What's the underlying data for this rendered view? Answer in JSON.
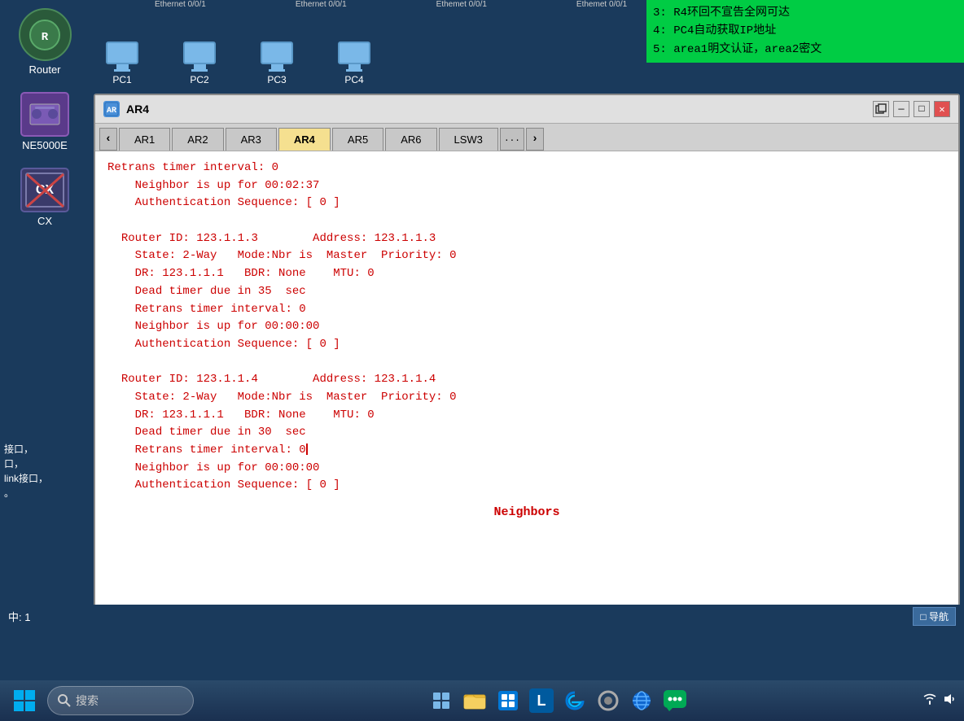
{
  "window": {
    "title": "AR4",
    "title_icon": "AR"
  },
  "tabs": [
    {
      "label": "AR1",
      "active": false
    },
    {
      "label": "AR2",
      "active": false
    },
    {
      "label": "AR3",
      "active": false
    },
    {
      "label": "AR4",
      "active": true
    },
    {
      "label": "AR5",
      "active": false
    },
    {
      "label": "AR6",
      "active": false
    },
    {
      "label": "LSW3",
      "active": false
    },
    {
      "label": "...",
      "active": false
    }
  ],
  "info_box": {
    "lines": [
      "3: R4环回不宣告全网可达",
      "4: PC4自动获取IP地址",
      "5: area1明文认证，area2密文"
    ]
  },
  "terminal": {
    "content_lines": [
      "Retrans timer interval: 0",
      "    Neighbor is up for 00:02:37",
      "    Authentication Sequence: [ 0 ]",
      "",
      "  Router ID: 123.1.1.3        Address: 123.1.1.3",
      "    State: 2-Way   Mode:Nbr is  Master  Priority: 0",
      "    DR: 123.1.1.1   BDR: None    MTU: 0",
      "    Dead timer due in 35  sec",
      "    Retrans timer interval: 0",
      "    Neighbor is up for 00:00:00",
      "    Authentication Sequence: [ 0 ]",
      "",
      "  Router ID: 123.1.1.4        Address: 123.1.1.4",
      "    State: 2-Way   Mode:Nbr is  Master  Priority: 0",
      "    DR: 123.1.1.1   BDR: None    MTU: 0",
      "    Dead timer due in 30  sec",
      "    Retrans timer interval: 0|",
      "    Neighbor is up for 00:00:00",
      "    Authentication Sequence: [ 0 ]"
    ],
    "footer_label": "Neighbors"
  },
  "devices": [
    {
      "label": "PC1",
      "ethernet": ""
    },
    {
      "label": "PC2",
      "ethernet": ""
    },
    {
      "label": "PC3",
      "ethernet": ""
    },
    {
      "label": "PC4",
      "ethernet": "Ethemet 0/0/1"
    }
  ],
  "ethernet_labels": [
    "Ethernet 0/0/1",
    "Ethernet 0/0/1",
    "Ethemet 0/0/1"
  ],
  "sidebar": {
    "items": [
      {
        "label": "Router",
        "type": "router"
      },
      {
        "label": "NE5000E",
        "type": "switch"
      },
      {
        "label": "CX",
        "type": "cx"
      }
    ],
    "bottom_text": "接口，\n口，\nlink接口，\n。"
  },
  "bottom_strip": {
    "left_text": "中: 1",
    "nav_label": "导航"
  },
  "taskbar": {
    "search_placeholder": "搜索",
    "icons": [
      "windows",
      "search",
      "taskview",
      "files",
      "store",
      "letter-l",
      "edge",
      "circle",
      "ie",
      "fish"
    ]
  },
  "win_controls": {
    "restore": "🗗",
    "minimize": "—",
    "maximize": "□",
    "close": "✕"
  }
}
